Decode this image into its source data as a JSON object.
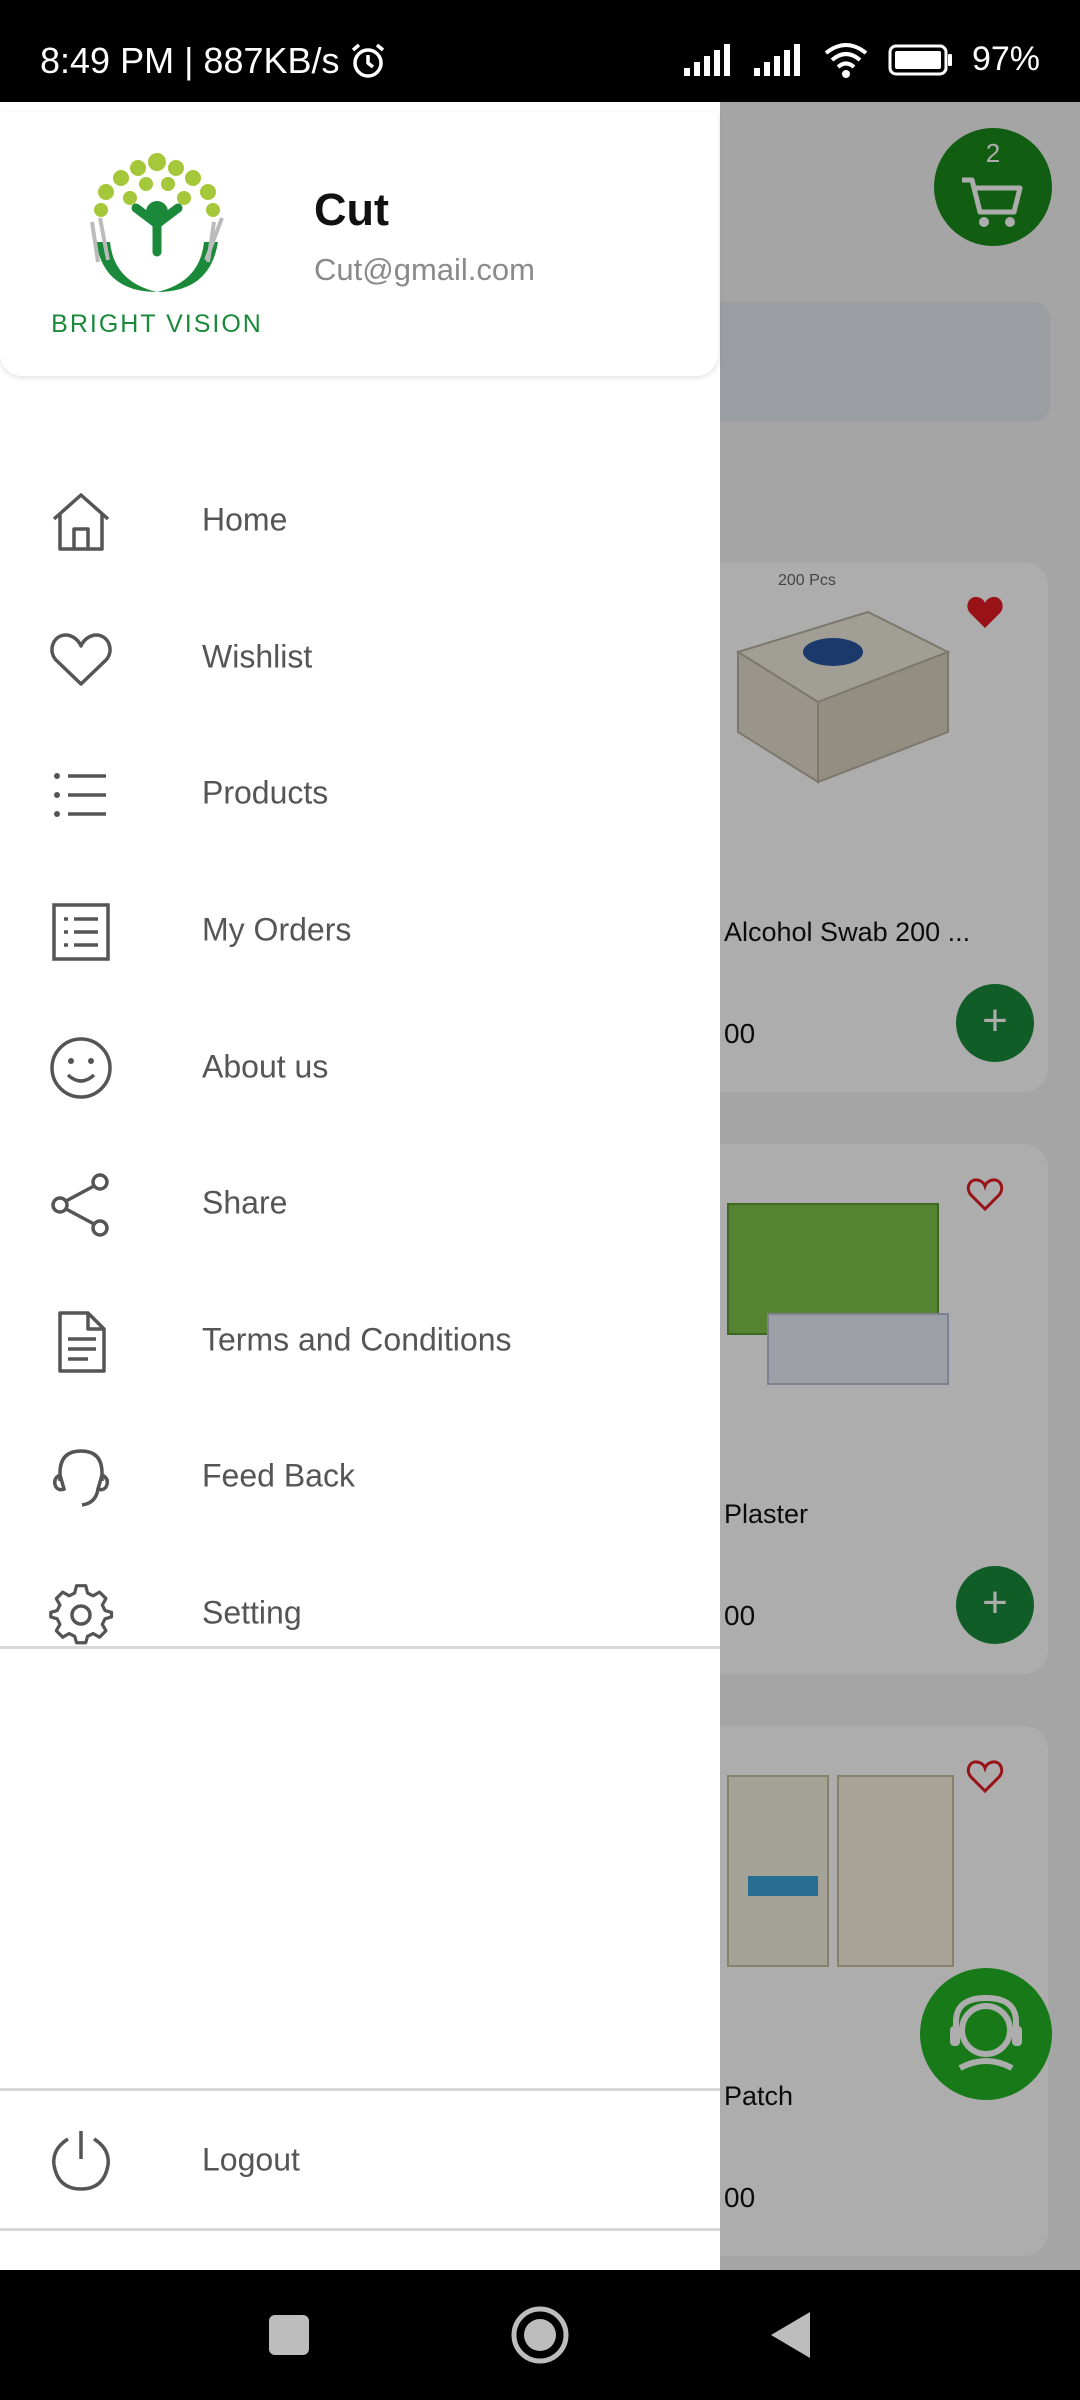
{
  "status_bar": {
    "time_speed": "8:49 PM | 887KB/s",
    "battery": "97%",
    "icons": [
      "alarm-icon",
      "signal-icon",
      "signal-icon",
      "wifi-icon",
      "battery-icon"
    ]
  },
  "background": {
    "cart_count": "2",
    "products": [
      {
        "name": "Alcohol Swab 200 ...",
        "price": "00",
        "wishlisted": true,
        "image_caption": "200 Pcs"
      },
      {
        "name": "Plaster",
        "price": "00",
        "wishlisted": false
      },
      {
        "name": "Patch",
        "price": "00",
        "wishlisted": false
      }
    ],
    "add_label": "+"
  },
  "drawer": {
    "logo_text": "BRIGHT VISION",
    "user_name": "Cut",
    "user_email": "Cut@gmail.com",
    "menu": [
      {
        "label": "Home",
        "icon": "home-icon"
      },
      {
        "label": "Wishlist",
        "icon": "heart-icon"
      },
      {
        "label": "Products",
        "icon": "list-icon"
      },
      {
        "label": "My Orders",
        "icon": "orders-icon"
      },
      {
        "label": "About us",
        "icon": "smile-icon"
      },
      {
        "label": "Share",
        "icon": "share-icon"
      },
      {
        "label": "Terms and Conditions",
        "icon": "document-icon"
      },
      {
        "label": "Feed Back",
        "icon": "headset-icon"
      },
      {
        "label": "Setting",
        "icon": "gear-icon"
      }
    ],
    "logout_label": "Logout"
  },
  "colors": {
    "brand_green": "#1a8a3a",
    "wishlist_red": "#e01b24",
    "menu_text": "#555555"
  }
}
